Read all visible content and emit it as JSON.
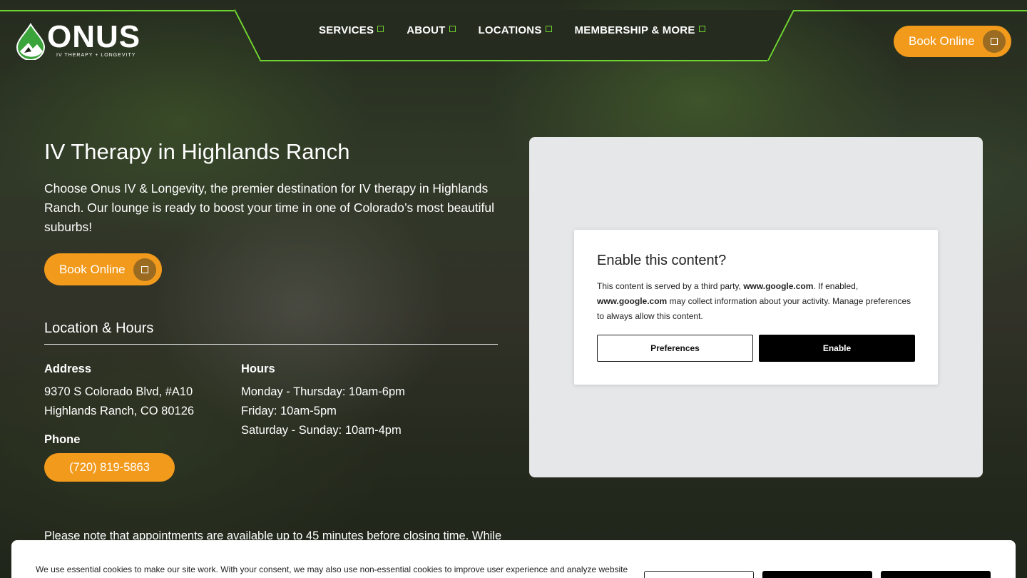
{
  "header": {
    "logo_text": "ONUS",
    "logo_tagline": "IV THERAPY + LONGEVITY",
    "nav": [
      {
        "label": "SERVICES"
      },
      {
        "label": "ABOUT"
      },
      {
        "label": "LOCATIONS"
      },
      {
        "label": "MEMBERSHIP & MORE"
      }
    ],
    "book_label": "Book Online"
  },
  "main": {
    "title": "IV Therapy in Highlands Ranch",
    "intro": "Choose Onus IV & Longevity, the premier destination for IV therapy in Highlands Ranch. Our lounge is ready to boost your time in one of Colorado’s most beautiful suburbs!",
    "book_label": "Book Online",
    "location_title": "Location & Hours",
    "address_label": "Address",
    "address_line1": "9370 S Colorado Blvd, #A10",
    "address_line2": "Highlands Ranch, CO 80126",
    "phone_label": "Phone",
    "phone": "(720) 819-5863",
    "hours_label": "Hours",
    "hours": [
      "Monday - Thursday: 10am-6pm",
      "Friday: 10am-5pm",
      "Saturday - Sunday: 10am-4pm"
    ],
    "note": "Please note that appointments are available up to 45 minutes before closing time. While"
  },
  "consent": {
    "title": "Enable this content?",
    "body_pre": "This content is served by a third party, ",
    "domain": "www.google.com",
    "body_mid": ". If enabled, ",
    "body_post": " may collect information about your activity. Manage preferences to always allow this content.",
    "preferences_label": "Preferences",
    "enable_label": "Enable"
  },
  "cookie": {
    "text": "We use essential cookies to make our site work. With your consent, we may also use non-essential cookies to improve user experience and analyze website"
  },
  "colors": {
    "accent": "#f29a1c",
    "nav_accent": "#6fd431",
    "nav_bg": "#262b1f"
  },
  "icons": {
    "nav_square": "square-outline-icon",
    "button_square": "square-outline-icon",
    "logo_mark": "drop-mountain-icon"
  }
}
